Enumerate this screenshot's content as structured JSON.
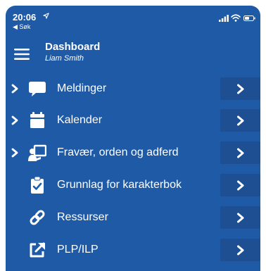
{
  "status_bar": {
    "time": "20:06",
    "back_label": "◀ Søk",
    "icons": [
      "location-arrow-icon",
      "signal-icon",
      "wifi-icon",
      "battery-icon"
    ]
  },
  "header": {
    "title": "Dashboard",
    "subtitle": "Liam Smith",
    "menu_icon": "hamburger-menu-icon"
  },
  "menu": {
    "items": [
      {
        "label": "Meldinger",
        "icon": "chat-bubble-icon",
        "expandable": true
      },
      {
        "label": "Kalender",
        "icon": "calendar-icon",
        "expandable": true
      },
      {
        "label": "Fravær, orden og adferd",
        "icon": "teacher-board-icon",
        "expandable": true
      },
      {
        "label": "Grunnlag for karakterbok",
        "icon": "clipboard-check-icon",
        "expandable": false
      },
      {
        "label": "Ressurser",
        "icon": "link-icon",
        "expandable": false
      },
      {
        "label": "PLP/ILP",
        "icon": "external-link-icon",
        "expandable": false
      }
    ]
  },
  "colors": {
    "background": "#1f5aa6",
    "button": "#1d4f92",
    "text": "#ffffff"
  }
}
